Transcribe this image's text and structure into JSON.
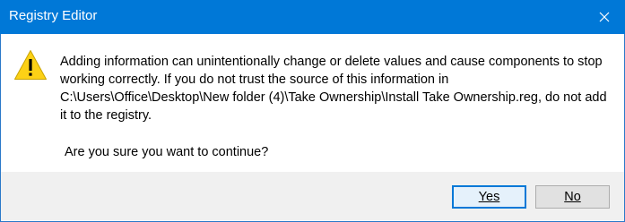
{
  "window": {
    "title": "Registry Editor",
    "accent_color": "#0078d7",
    "close_icon": "close-icon"
  },
  "dialog": {
    "icon": "warning-icon",
    "message": "Adding information can unintentionally change or delete values and cause components to stop working correctly. If you do not trust the source of this information in C:\\Users\\Office\\Desktop\\New folder (4)\\Take Ownership\\Install Take Ownership.reg, do not add it to the registry.",
    "question": "Are you sure you want to continue?"
  },
  "buttons": {
    "yes_label": "Yes",
    "no_label": "No",
    "default": "Yes"
  }
}
